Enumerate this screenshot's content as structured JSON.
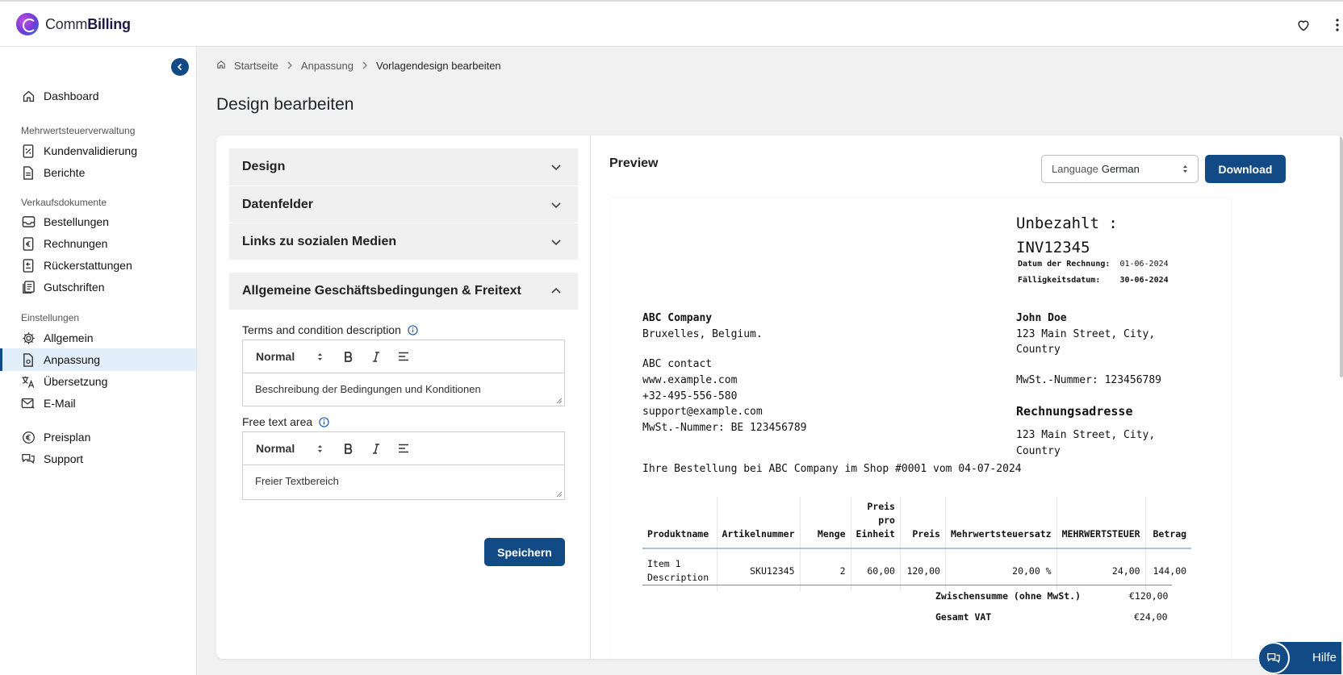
{
  "app": {
    "brand_light": "Comm",
    "brand_bold": "Billing"
  },
  "colors": {
    "primary": "#124a86",
    "active_bg": "#e2eef9",
    "page_bg": "#f1f1f2"
  },
  "topbar": {
    "icons": [
      "heart-icon",
      "more-vertical-icon"
    ]
  },
  "sidebar": {
    "dashboard": "Dashboard",
    "section_vat": "Mehrwertsteuerverwaltung",
    "kundenvalidierung": "Kundenvalidierung",
    "berichte": "Berichte",
    "section_sales": "Verkaufsdokumente",
    "bestellungen": "Bestellungen",
    "rechnungen": "Rechnungen",
    "rueckerstattungen": "Rückerstattungen",
    "gutschriften": "Gutschriften",
    "section_settings": "Einstellungen",
    "allgemein": "Allgemein",
    "anpassung": "Anpassung",
    "uebersetzung": "Übersetzung",
    "email": "E-Mail",
    "preisplan": "Preisplan",
    "support": "Support"
  },
  "breadcrumb": {
    "home": "Startseite",
    "parent": "Anpassung",
    "current": "Vorlagendesign bearbeiten"
  },
  "page": {
    "title": "Design bearbeiten"
  },
  "accordion": {
    "design": "Design",
    "datenfelder": "Datenfelder",
    "social": "Links zu sozialen Medien",
    "terms": "Allgemeine Geschäftsbedingungen & Freitext"
  },
  "terms_field": {
    "label": "Terms and condition description",
    "format": "Normal",
    "value": "Beschreibung der Bedingungen und Konditionen"
  },
  "free_field": {
    "label": "Free text area",
    "format": "Normal",
    "value": "Freier Textbereich"
  },
  "save_label": "Speichern",
  "preview": {
    "title": "Preview",
    "language_label": "Language",
    "language_value": "German",
    "download_label": "Download"
  },
  "invoice": {
    "status_line1": "Unbezahlt :",
    "status_line2": "INV12345",
    "date_label": "Datum der Rechnung:",
    "date_value": "01-06-2024",
    "due_label": "Fälligkeitsdatum:",
    "due_value": "30-06-2024",
    "seller_name": "ABC Company",
    "seller_city": "Bruxelles, Belgium.",
    "seller_contact": "ABC contact",
    "seller_web": "www.example.com",
    "seller_phone": "+32-495-556-580",
    "seller_email": "support@example.com",
    "seller_vat": "MwSt.-Nummer: BE 123456789",
    "buyer_name": "John Doe",
    "buyer_addr1": "123 Main Street, City,",
    "buyer_addr2": "Country",
    "buyer_vat": "MwSt.-Nummer: 123456789",
    "billing_head": "Rechnungsadresse",
    "billing_addr1": "123 Main Street, City,",
    "billing_addr2": "Country",
    "order_line": "Ihre Bestellung bei ABC Company im Shop #0001 vom 04-07-2024",
    "columns": {
      "product": "Produktname",
      "sku": "Artikelnummer",
      "qty": "Menge",
      "unit_1": "Preis",
      "unit_2": "pro",
      "unit_3": "Einheit",
      "price": "Preis",
      "vat_rate": "Mehrwertsteuersatz",
      "vat": "MEHRWERTSTEUER",
      "amount": "Betrag"
    },
    "row": {
      "product_1": "Item 1",
      "product_2": "Description",
      "sku": "SKU12345",
      "qty": "2",
      "unit": "60,00",
      "price": "120,00",
      "vat_rate": "20,00 %",
      "vat": "24,00",
      "amount": "144,00"
    },
    "subtotal_label": "Zwischensumme (ohne MwSt.)",
    "subtotal_value": "€120,00",
    "vat_total_label": "Gesamt VAT",
    "vat_total_value": "€24,00"
  },
  "help_label": "Hilfe"
}
